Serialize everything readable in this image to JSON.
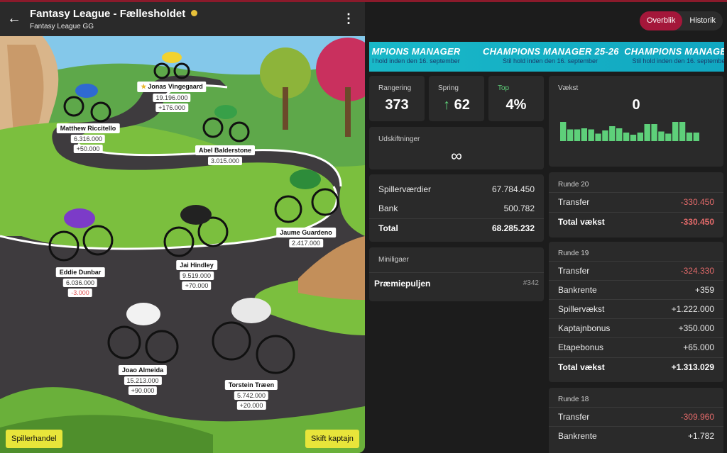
{
  "header": {
    "back_icon": "arrow-left-icon",
    "title": "Fantasy League - Fællesholdet",
    "subtitle": "Fantasy League GG",
    "menu_icon": "kebab-menu-icon"
  },
  "riders": [
    {
      "name": "Jonas Vingegaard",
      "value": "19.196.000",
      "change": "+176.000",
      "captain": true,
      "negative": false
    },
    {
      "name": "Matthew Riccitello",
      "value": "6.316.000",
      "change": "+50.000",
      "captain": false,
      "negative": false
    },
    {
      "name": "Abel Balderstone",
      "value": "3.015.000",
      "change": "",
      "captain": false,
      "negative": false
    },
    {
      "name": "Jaume Guardeno",
      "value": "2.417.000",
      "change": "",
      "captain": false,
      "negative": false
    },
    {
      "name": "Eddie Dunbar",
      "value": "6.036.000",
      "change": "-3.000",
      "captain": false,
      "negative": true
    },
    {
      "name": "Jai Hindley",
      "value": "9.519.000",
      "change": "+70.000",
      "captain": false,
      "negative": false
    },
    {
      "name": "Joao Almeida",
      "value": "15.213.000",
      "change": "+90.000",
      "captain": false,
      "negative": false
    },
    {
      "name": "Torstein Træen",
      "value": "5.742.000",
      "change": "+20.000",
      "captain": false,
      "negative": false
    }
  ],
  "buttons": {
    "trade": "Spillerhandel",
    "captain": "Skift kaptajn"
  },
  "tabs": [
    {
      "label": "Overblik",
      "active": true
    },
    {
      "label": "Historik",
      "active": false
    }
  ],
  "banner": {
    "title_a": "CHAMPIONS MANAGER",
    "title_b": "25-26",
    "sub": "Stil hold inden den 16. september",
    "partial_title": "MPIONS MANAGER",
    "partial_sub": "l hold inden den 16. september",
    "tail_title": "CHAMPIONS MANAGER",
    "tail_sub": "Stil hold inden den 16. septembe"
  },
  "stats": {
    "rank_label": "Rangering",
    "rank_value": "373",
    "jump_label": "Spring",
    "jump_value": "62",
    "jump_icon": "arrow-up-icon",
    "top_label": "Top",
    "top_value": "4%",
    "growth_label": "Vækst",
    "growth_value": "0",
    "swaps_label": "Udskiftninger",
    "swaps_value": "∞"
  },
  "growth_bars": [
    0.9,
    0.55,
    0.55,
    0.6,
    0.55,
    0.35,
    0.5,
    0.7,
    0.6,
    0.4,
    0.3,
    0.4,
    0.8,
    0.8,
    0.45,
    0.35,
    0.9,
    0.9,
    0.4,
    0.4
  ],
  "values": {
    "rows": [
      {
        "label": "Spillerværdier",
        "value": "67.784.450"
      },
      {
        "label": "Bank",
        "value": "500.782"
      }
    ],
    "total_label": "Total",
    "total_value": "68.285.232"
  },
  "minileagues": {
    "title": "Miniligaer",
    "name": "Præmiepuljen",
    "rank": "#342"
  },
  "rounds": [
    {
      "title": "Runde 20",
      "rows": [
        {
          "label": "Transfer",
          "value": "-330.450",
          "neg": true
        }
      ],
      "total_label": "Total vækst",
      "total_value": "-330.450",
      "total_neg": true
    },
    {
      "title": "Runde 19",
      "rows": [
        {
          "label": "Transfer",
          "value": "-324.330",
          "neg": true
        },
        {
          "label": "Bankrente",
          "value": "+359",
          "neg": false
        },
        {
          "label": "Spillervækst",
          "value": "+1.222.000",
          "neg": false
        },
        {
          "label": "Kaptajnbonus",
          "value": "+350.000",
          "neg": false
        },
        {
          "label": "Etapebonus",
          "value": "+65.000",
          "neg": false
        }
      ],
      "total_label": "Total vækst",
      "total_value": "+1.313.029",
      "total_neg": false
    },
    {
      "title": "Runde 18",
      "rows": [
        {
          "label": "Transfer",
          "value": "-309.960",
          "neg": true
        },
        {
          "label": "Bankrente",
          "value": "+1.782",
          "neg": false
        }
      ]
    }
  ],
  "colors": {
    "accent": "#a4173a",
    "negative": "#e36a6a",
    "positive": "#5ed07a",
    "button_yellow": "#e8e53a",
    "banner": "#19b8c8"
  }
}
